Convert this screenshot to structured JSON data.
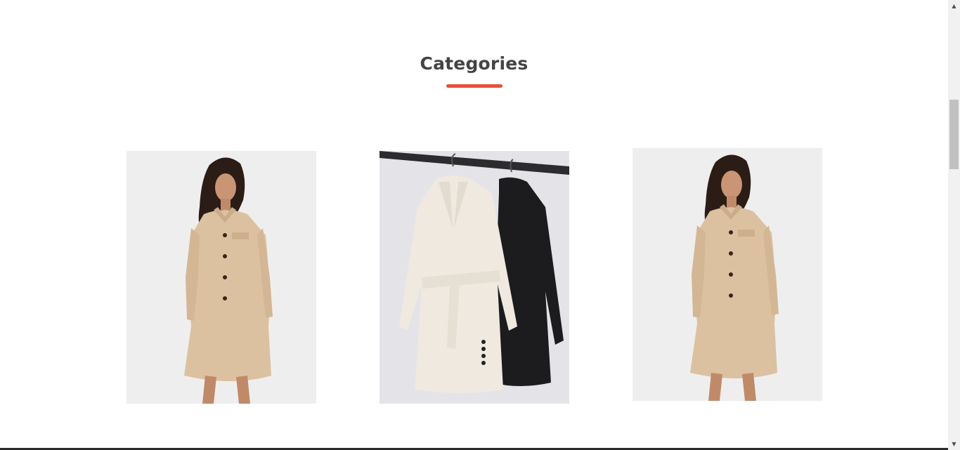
{
  "section": {
    "title": "Categories",
    "accent_color": "#e8503a"
  },
  "categories": [
    {
      "image": "beige-coat-dress-model"
    },
    {
      "image": "white-and-black-blazer-dresses-on-hangers"
    },
    {
      "image": "beige-coat-dress-model"
    }
  ],
  "scrollbar": {
    "up_icon": "▲",
    "down_icon": "▼"
  }
}
